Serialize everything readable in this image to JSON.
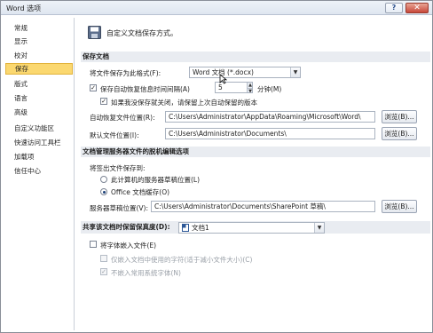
{
  "window": {
    "title": "Word 选项",
    "help_label": "?",
    "close_label": "✕"
  },
  "sidebar": {
    "items": [
      {
        "label": "常规"
      },
      {
        "label": "显示"
      },
      {
        "label": "校对"
      },
      {
        "label": "保存",
        "active": true
      },
      {
        "label": "版式"
      },
      {
        "label": "语言"
      },
      {
        "label": "高级"
      },
      {
        "label": "自定义功能区"
      },
      {
        "label": "快速访问工具栏"
      },
      {
        "label": "加载项"
      },
      {
        "label": "信任中心"
      }
    ]
  },
  "main": {
    "header_text": "自定义文档保存方式。",
    "save_section": {
      "title": "保存文档",
      "format_label": "将文件保存为此格式(F):",
      "format_value": "Word 文档 (*.docx)",
      "autorecover_label": "保存自动恢复信息时间间隔(A)",
      "autorecover_checked": true,
      "autorecover_minutes": "5",
      "minutes_label": "分钟(M)",
      "keep_last_label": "如果我没保存就关闭，请保留上次自动保留的版本",
      "keep_last_checked": true,
      "autorecover_location_label": "自动恢复文件位置(R):",
      "autorecover_location_value": "C:\\Users\\Administrator\\AppData\\Roaming\\Microsoft\\Word\\",
      "default_location_label": "默认文件位置(I):",
      "default_location_value": "C:\\Users\\Administrator\\Documents\\",
      "browse_label": "浏览(B)..."
    },
    "offline_section": {
      "title": "文档管理服务器文件的脱机编辑选项",
      "checkout_label": "将签出文件保存到:",
      "option_server_label": "此计算机的服务器草稿位置(L)",
      "option_office_label": "Office 文档缓存(O)",
      "selected_option": "office",
      "drafts_label": "服务器草稿位置(V):",
      "drafts_value": "C:\\Users\\Administrator\\Documents\\SharePoint 草稿\\",
      "browse_label": "浏览(B)..."
    },
    "fidelity_section": {
      "title": "共享该文档时保留保真度(D):",
      "document_value": "文档1",
      "embed_fonts_label": "将字体嵌入文件(E)",
      "embed_fonts_checked": false,
      "embed_used_chars_label": "仅嵌入文档中使用的字符(适于减小文件大小)(C)",
      "no_common_fonts_label": "不嵌入常用系统字体(N)"
    }
  },
  "colors": {
    "active_nav": "#fbd870",
    "section_bar": "#e9ecf1",
    "accent": "#1a3f78"
  }
}
